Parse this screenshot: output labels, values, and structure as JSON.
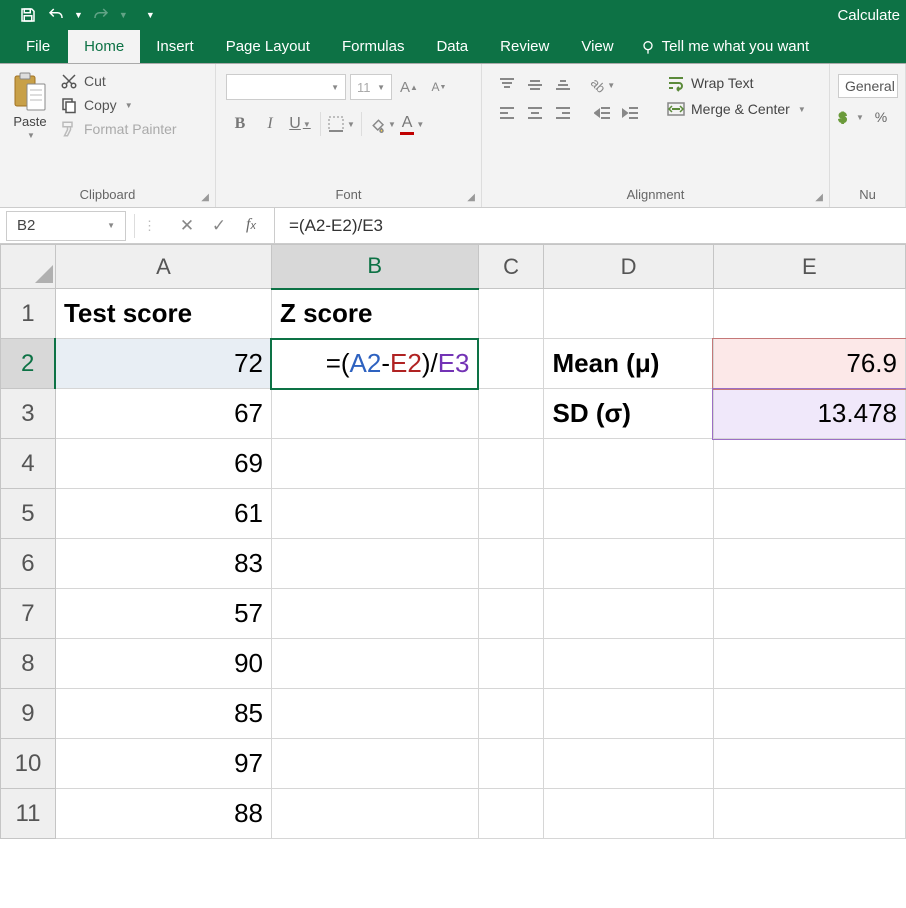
{
  "titlebar": {
    "right_text": "Calculate"
  },
  "tabs": {
    "file": "File",
    "home": "Home",
    "insert": "Insert",
    "page_layout": "Page Layout",
    "formulas": "Formulas",
    "data": "Data",
    "review": "Review",
    "view": "View",
    "tellme": "Tell me what you want"
  },
  "ribbon": {
    "clipboard": {
      "paste": "Paste",
      "cut": "Cut",
      "copy": "Copy",
      "format_painter": "Format Painter",
      "group": "Clipboard"
    },
    "font": {
      "name": "",
      "size": "11",
      "group": "Font",
      "bold": "B",
      "italic": "I",
      "underline": "U"
    },
    "alignment": {
      "wrap": "Wrap Text",
      "merge": "Merge & Center",
      "group": "Alignment"
    },
    "number": {
      "format": "General",
      "group": "Nu"
    }
  },
  "namebox": "B2",
  "formula": "=(A2-E2)/E3",
  "sheet": {
    "cols": [
      "A",
      "B",
      "C",
      "D",
      "E"
    ],
    "rows": [
      "1",
      "2",
      "3",
      "4",
      "5",
      "6",
      "7",
      "8",
      "9",
      "10",
      "11"
    ],
    "header_A": "Test score",
    "header_B": "Z score",
    "A": {
      "2": "72",
      "3": "67",
      "4": "69",
      "5": "61",
      "6": "83",
      "7": "57",
      "8": "90",
      "9": "85",
      "10": "97",
      "11": "88"
    },
    "D": {
      "2": "Mean (μ)",
      "3": "SD (σ)"
    },
    "E": {
      "2": "76.9",
      "3": "13.478"
    },
    "B2_formula_parts": {
      "eq": "=(",
      "r1": "A2",
      "m": "-",
      "r2": "E2",
      "p": ")/",
      "r3": "E3"
    }
  }
}
